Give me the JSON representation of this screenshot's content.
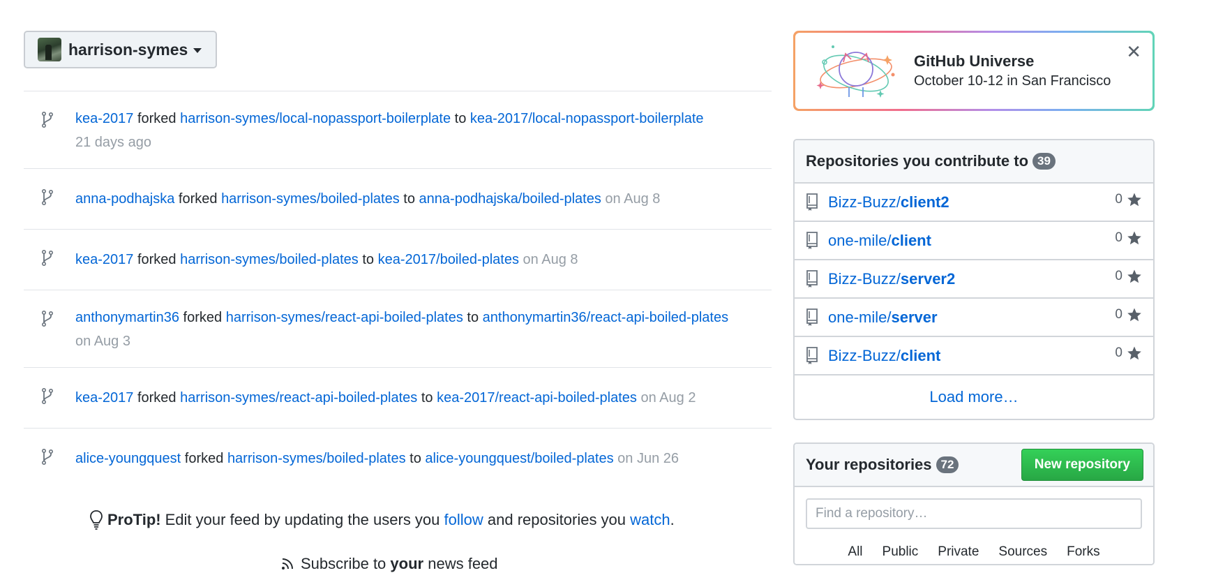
{
  "context": {
    "username": "harrison-symes"
  },
  "feed": [
    {
      "actor": "kea-2017",
      "action": "forked",
      "source": "harrison-symes/local-nopassport-boilerplate",
      "connector": "to",
      "target": "kea-2017/local-nopassport-boilerplate",
      "time": "21 days ago"
    },
    {
      "actor": "anna-podhajska",
      "action": "forked",
      "source": "harrison-symes/boiled-plates",
      "connector": "to",
      "target": "anna-podhajska/boiled-plates",
      "time": "on Aug 8"
    },
    {
      "actor": "kea-2017",
      "action": "forked",
      "source": "harrison-symes/boiled-plates",
      "connector": "to",
      "target": "kea-2017/boiled-plates",
      "time": "on Aug 8"
    },
    {
      "actor": "anthonymartin36",
      "action": "forked",
      "source": "harrison-symes/react-api-boiled-plates",
      "connector": "to",
      "target": "anthonymartin36/react-api-boiled-plates",
      "time": "on Aug 3"
    },
    {
      "actor": "kea-2017",
      "action": "forked",
      "source": "harrison-symes/react-api-boiled-plates",
      "connector": "to",
      "target": "kea-2017/react-api-boiled-plates",
      "time": "on Aug 2"
    },
    {
      "actor": "alice-youngquest",
      "action": "forked",
      "source": "harrison-symes/boiled-plates",
      "connector": "to",
      "target": "alice-youngquest/boiled-plates",
      "time": "on Jun 26"
    }
  ],
  "protip": {
    "label": "ProTip!",
    "text1": "Edit your feed by updating the users you",
    "link1": "follow",
    "text2": "and repositories you",
    "link2": "watch",
    "end": "."
  },
  "subscribe": {
    "text1": "Subscribe to",
    "bold": "your",
    "text2": "news feed"
  },
  "universe": {
    "title": "GitHub Universe",
    "subtitle": "October 10-12 in San Francisco",
    "close": "✕"
  },
  "contrib": {
    "title": "Repositories you contribute to",
    "count": "39",
    "repos": [
      {
        "owner": "Bizz-Buzz/",
        "name": "client2",
        "stars": "0"
      },
      {
        "owner": "one-mile/",
        "name": "client",
        "stars": "0"
      },
      {
        "owner": "Bizz-Buzz/",
        "name": "server2",
        "stars": "0"
      },
      {
        "owner": "one-mile/",
        "name": "server",
        "stars": "0"
      },
      {
        "owner": "Bizz-Buzz/",
        "name": "client",
        "stars": "0"
      }
    ],
    "load_more": "Load more…"
  },
  "yours": {
    "title": "Your repositories",
    "count": "72",
    "new_button": "New repository",
    "search_placeholder": "Find a repository…",
    "tabs": [
      "All",
      "Public",
      "Private",
      "Sources",
      "Forks"
    ]
  },
  "colors": {
    "link": "#0366d6",
    "primary_button": "#28a745",
    "muted": "#959da5"
  }
}
